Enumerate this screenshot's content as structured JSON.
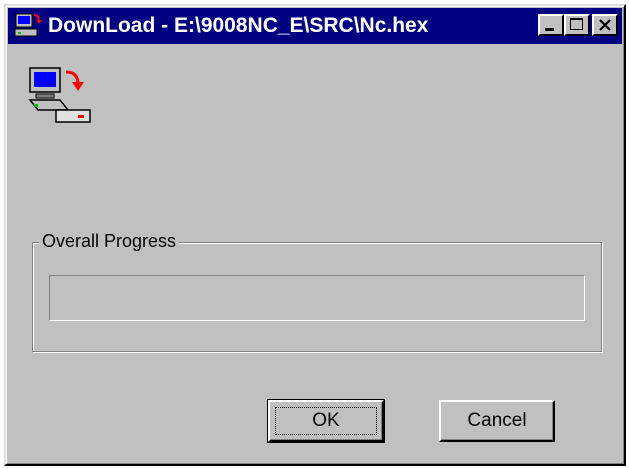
{
  "window": {
    "title": "DownLoad - E:\\9008NC_E\\SRC\\Nc.hex",
    "controls": [
      "minimize-icon",
      "maximize-icon",
      "close-icon"
    ]
  },
  "icon": {
    "name": "download-to-device-icon"
  },
  "progress_group": {
    "label": "Overall Progress",
    "progress_percent": 0
  },
  "buttons": {
    "ok_label": "OK",
    "cancel_label": "Cancel"
  },
  "colors": {
    "titlebar": "#000080",
    "face": "#c0c0c0"
  }
}
